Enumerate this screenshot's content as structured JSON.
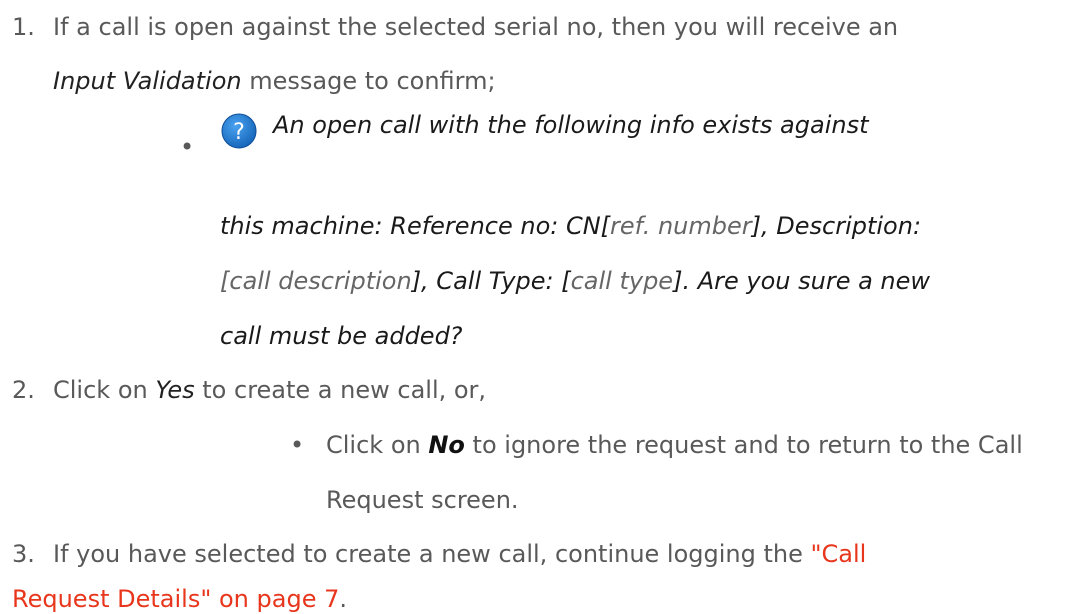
{
  "steps": [
    {
      "number": "1.",
      "text_a": "If a call is open against the selected serial no, then you will receive an",
      "text_b_em": "Input Validation",
      "text_b_rest": " message to confirm;"
    },
    {
      "number": "2.",
      "text_a": "Click on ",
      "em": "Yes",
      "text_b": " to create a new call, or,"
    },
    {
      "number": "3.",
      "text_a": "If you have selected to create a new call, continue logging the ",
      "link_line1": "\"Call",
      "link_line2": "Request Details\" on page 7",
      "text_end": "."
    }
  ],
  "message": {
    "icon": "question-help-icon",
    "line1": "An open call with the following info exists against",
    "line2_a": "this machine: Reference no: CN[",
    "line2_b": "ref. number",
    "line2_c": "], Description:",
    "line3_a": "[",
    "line3_b": "call description",
    "line3_c": "], Call Type: [",
    "line3_d": "call type",
    "line3_e": "]. Are you sure a new",
    "line4": "call must be added?"
  },
  "sub_bullet": {
    "text_a": "Click on ",
    "em": "No",
    "text_b": " to ignore the request and to return to the Call",
    "line2": "Request screen."
  },
  "colors": {
    "body_text": "#595959",
    "link": "#e8361c",
    "icon_blue": "#1e78d2"
  }
}
